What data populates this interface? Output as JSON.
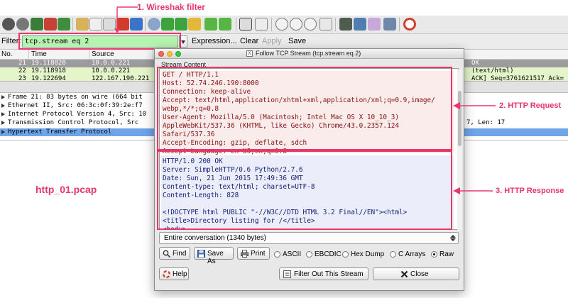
{
  "annotations": {
    "filter_note": "1. Wireshak filter",
    "request_note": "2. HTTP Request",
    "response_note": "3. HTTP Response",
    "pcap_name": "http_01.pcap"
  },
  "filter_bar": {
    "label": "Filter:",
    "value": "tcp.stream eq 2",
    "expression": "Expression...",
    "clear": "Clear",
    "apply": "Apply",
    "save": "Save"
  },
  "packet_list": {
    "columns": [
      "No.",
      "Time",
      "Source"
    ],
    "rows": [
      {
        "no": "21",
        "time": "19.118828",
        "source": "10.0.0.221",
        "right": "OK"
      },
      {
        "no": "22",
        "time": "19.118918",
        "source": "10.0.0.221",
        "right": "(text/html)"
      },
      {
        "no": "23",
        "time": "19.122694",
        "source": "122.167.190.221",
        "right": "ACK] Seq=3761621517 Ack="
      }
    ]
  },
  "details": {
    "rows": [
      {
        "text": "Frame 21: 83 bytes on wire (664 bit",
        "right": ""
      },
      {
        "text": "Ethernet II, Src: 06:3c:0f:39:2e:f7",
        "right": ""
      },
      {
        "text": "Internet Protocol Version 4, Src: 10",
        "right": ""
      },
      {
        "text": "Transmission Control Protocol, Src",
        "right": "7, Len: 17"
      },
      {
        "text": "Hypertext Transfer Protocol",
        "right": ""
      }
    ]
  },
  "dialog": {
    "title": "Follow TCP Stream (tcp.stream eq 2)",
    "stream_label": "Stream Content",
    "request_lines": [
      "GET / HTTP/1.1",
      "Host: 52.74.246.190:8000",
      "Connection: keep-alive",
      "Accept: text/html,application/xhtml+xml,application/xml;q=0.9,image/",
      "webp,*/*;q=0.8",
      "User-Agent: Mozilla/5.0 (Macintosh; Intel Mac OS X 10_10_3)",
      "AppleWebKit/537.36 (KHTML, like Gecko) Chrome/43.0.2357.124",
      "Safari/537.36",
      "Accept-Encoding: gzip, deflate, sdch",
      "Accept-Language: en-US,en;q=0.8"
    ],
    "response_lines": [
      "HTTP/1.0 200 OK",
      "Server: SimpleHTTP/0.6 Python/2.7.6",
      "Date: Sun, 21 Jun 2015 17:49:36 GMT",
      "Content-type: text/html; charset=UTF-8",
      "Content-Length: 828",
      "",
      "<!DOCTYPE html PUBLIC \"-//W3C//DTD HTML 3.2 Final//EN\"><html>",
      "<title>Directory listing for /</title>",
      "<body>"
    ],
    "conversation": "Entire conversation (1340 bytes)",
    "find": "Find",
    "save_as": "Save As",
    "print": "Print",
    "formats": [
      "ASCII",
      "EBCDIC",
      "Hex Dump",
      "C Arrays",
      "Raw"
    ],
    "selected_format": "Raw",
    "help": "Help",
    "filter_out": "Filter Out This Stream",
    "close": "Close"
  }
}
